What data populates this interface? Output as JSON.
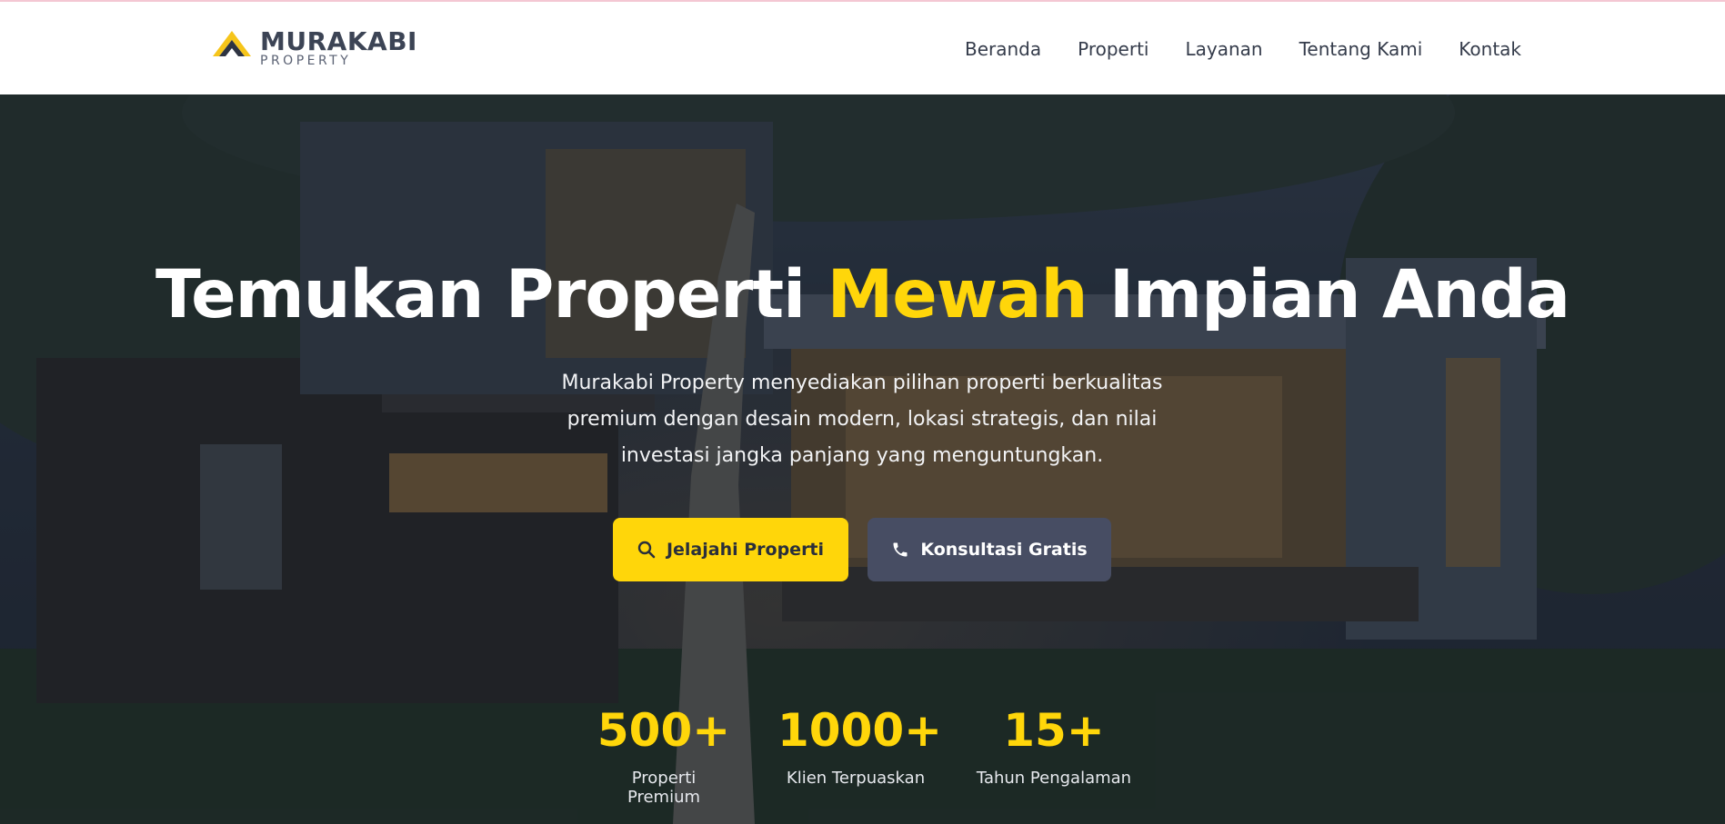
{
  "brand": {
    "name": "MURAKABI",
    "tagline": "PROPERTY",
    "accent_color": "#ffd60a"
  },
  "nav": {
    "items": [
      "Beranda",
      "Properti",
      "Layanan",
      "Tentang Kami",
      "Kontak"
    ]
  },
  "hero": {
    "headline_before": "Temukan Properti",
    "headline_accent": "Mewah",
    "headline_after": "Impian Anda",
    "lead": "Murakabi Property menyediakan pilihan properti berkualitas premium dengan desain modern, lokasi strategis, dan nilai investasi jangka panjang yang menguntungkan.",
    "primary_button": {
      "label": "Jelajahi Properti",
      "icon": "search-icon"
    },
    "secondary_button": {
      "label": "Konsultasi Gratis",
      "icon": "phone-icon"
    }
  },
  "stats": [
    {
      "value": "500+",
      "label": "Properti Premium"
    },
    {
      "value": "1000+",
      "label": "Klien Terpuaskan"
    },
    {
      "value": "15+",
      "label": "Tahun Pengalaman"
    }
  ],
  "colors": {
    "accent": "#ffd60a",
    "secondary_button": "#474d63",
    "nav_text": "#353c4b"
  }
}
